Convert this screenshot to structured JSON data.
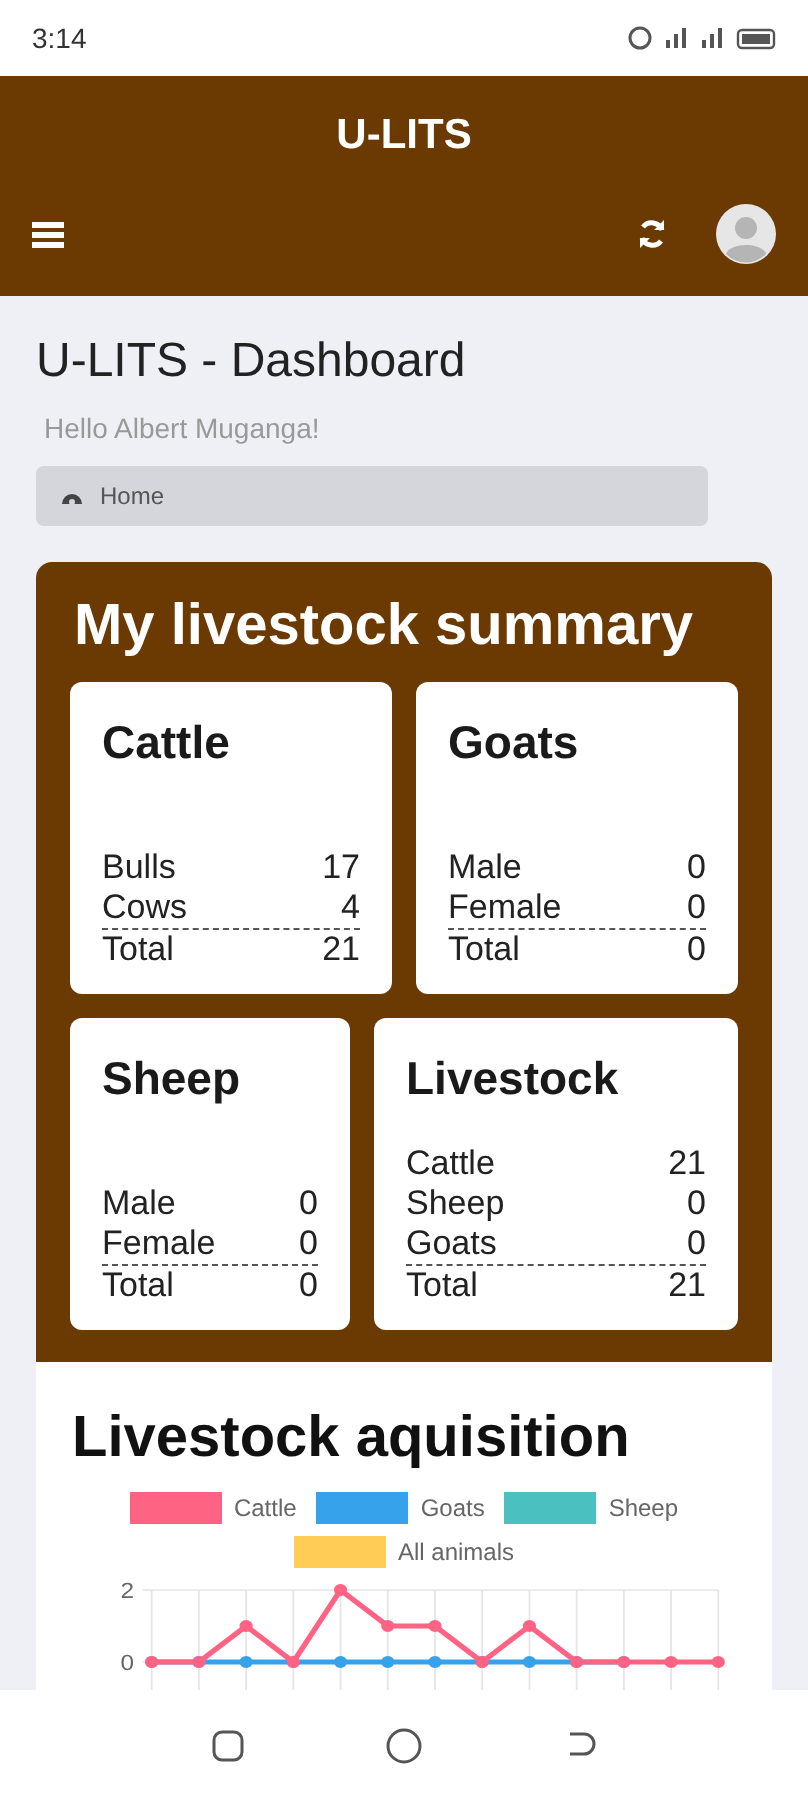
{
  "status_bar": {
    "time": "3:14"
  },
  "header": {
    "title": "U-LITS"
  },
  "page": {
    "title": "U-LITS - Dashboard",
    "greeting": "Hello Albert Muganga!",
    "breadcrumb": "Home"
  },
  "summary": {
    "title": "My livestock summary",
    "cards": [
      {
        "title": "Cattle",
        "rows": [
          {
            "label": "Bulls",
            "value": "17"
          },
          {
            "label": "Cows",
            "value": "4"
          }
        ],
        "total": {
          "label": "Total",
          "value": "21"
        }
      },
      {
        "title": "Goats",
        "rows": [
          {
            "label": "Male",
            "value": "0"
          },
          {
            "label": "Female",
            "value": "0"
          }
        ],
        "total": {
          "label": "Total",
          "value": "0"
        }
      },
      {
        "title": "Sheep",
        "rows": [
          {
            "label": "Male",
            "value": "0"
          },
          {
            "label": "Female",
            "value": "0"
          }
        ],
        "total": {
          "label": "Total",
          "value": "0"
        }
      },
      {
        "title": "Livestock",
        "rows": [
          {
            "label": "Cattle",
            "value": "21"
          },
          {
            "label": "Sheep",
            "value": "0"
          },
          {
            "label": "Goats",
            "value": "0"
          }
        ],
        "total": {
          "label": "Total",
          "value": "21"
        }
      }
    ]
  },
  "acquisition": {
    "title": "Livestock aquisition",
    "chart_data": {
      "type": "line",
      "grid": true,
      "ylim": [
        0,
        2
      ],
      "yticks": [
        0,
        2
      ],
      "series": [
        {
          "name": "Cattle",
          "color": "#ff6384",
          "marker": true,
          "values": [
            0,
            0,
            1,
            0,
            2,
            1,
            1,
            0,
            1,
            0,
            0,
            0,
            0
          ]
        },
        {
          "name": "Goats",
          "color": "#36a2eb",
          "marker": true,
          "values": [
            0,
            0,
            0,
            0,
            0,
            0,
            0,
            0,
            0,
            0,
            0,
            null,
            null
          ]
        },
        {
          "name": "Sheep",
          "color": "#4bc0c0",
          "values": [
            null,
            null,
            null,
            null,
            null,
            null,
            null,
            null,
            null,
            null,
            null,
            null,
            null
          ]
        },
        {
          "name": "All animals",
          "color": "#ffcd56",
          "values": [
            null,
            null,
            null,
            null,
            null,
            null,
            null,
            null,
            null,
            null,
            null,
            null,
            null
          ]
        }
      ]
    }
  }
}
